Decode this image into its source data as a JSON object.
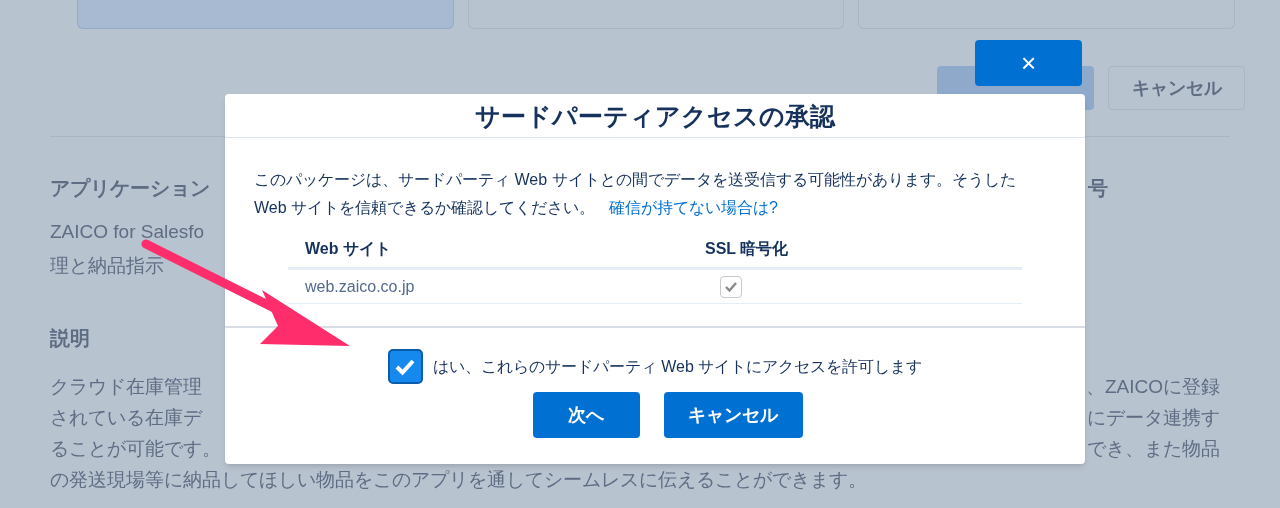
{
  "background": {
    "tabs": [
      {
        "selected": true
      },
      {
        "selected": false
      },
      {
        "selected": false
      }
    ],
    "cancel_button": "キャンセル",
    "app_heading": {
      "left": "アプリケーション",
      "right": "号"
    },
    "app_text": [
      "ZAICO for Salesfo",
      "理と納品指示"
    ],
    "description_heading": "説明",
    "description_lines": [
      {
        "left": "クラウド在庫管理",
        "right": "、ZAICOに登録"
      },
      {
        "left": "されている在庫デ",
        "right": "にデータ連携す"
      },
      {
        "left": "ることが可能です。",
        "right": "でき、また物品"
      },
      {
        "left": "の発送現場等に納品してほしい物品をこのアプリを通してシームレスに伝えることができます。"
      }
    ]
  },
  "close_button": "×",
  "dialog": {
    "title": "サードパーティアクセスの承認",
    "message": "このパッケージは、サードパーティ Web サイトとの間でデータを送受信する可能性があります。そうした Web サイトを信頼できるか確認してください。",
    "help_link": "確信が持てない場合は?",
    "table": {
      "columns": [
        "Web サイト",
        "SSL 暗号化"
      ],
      "rows": [
        {
          "site": "web.zaico.co.jp",
          "ssl": true
        }
      ]
    },
    "consent": {
      "label": "はい、これらのサードパーティ Web サイトにアクセスを許可します",
      "checked": true
    },
    "buttons": [
      "次へ",
      "キャンセル"
    ]
  }
}
